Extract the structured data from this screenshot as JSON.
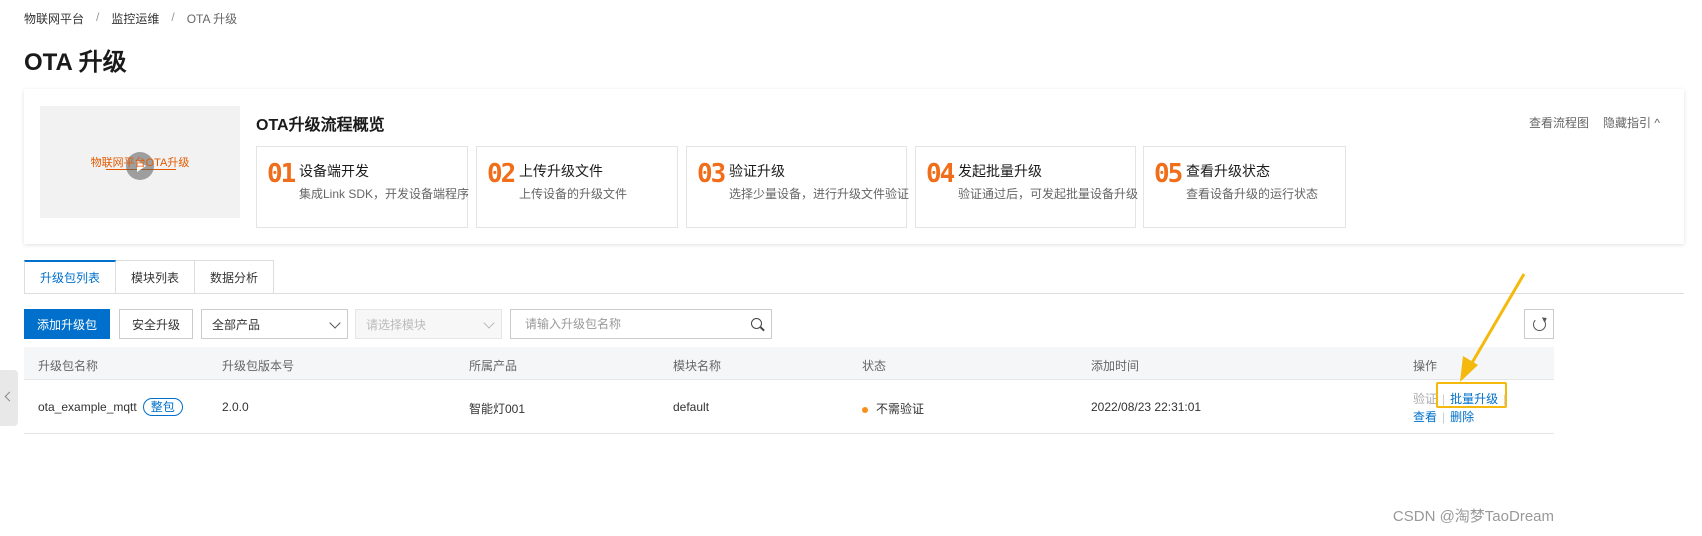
{
  "breadcrumb": [
    "物联网平台",
    "监控运维",
    "OTA 升级"
  ],
  "page_title": "OTA 升级",
  "guide": {
    "video_text": "物联网平台OTA升级",
    "title": "OTA升级流程概览",
    "links": [
      "查看流程图",
      "隐藏指引 ^"
    ],
    "steps": [
      {
        "num": "01",
        "title": "设备端开发",
        "desc": "集成Link SDK，开发设备端程序"
      },
      {
        "num": "02",
        "title": "上传升级文件",
        "desc": "上传设备的升级文件"
      },
      {
        "num": "03",
        "title": "验证升级",
        "desc": "选择少量设备，进行升级文件验证"
      },
      {
        "num": "04",
        "title": "发起批量升级",
        "desc": "验证通过后，可发起批量设备升级"
      },
      {
        "num": "05",
        "title": "查看升级状态",
        "desc": "查看设备升级的运行状态"
      }
    ]
  },
  "tabs": [
    "升级包列表",
    "模块列表",
    "数据分析"
  ],
  "toolbar": {
    "add_label": "添加升级包",
    "secure_label": "安全升级",
    "product_select": "全部产品",
    "module_select": "请选择模块",
    "search_placeholder": "请输入升级包名称"
  },
  "table": {
    "headers": [
      "升级包名称",
      "升级包版本号",
      "所属产品",
      "模块名称",
      "状态",
      "添加时间",
      "操作"
    ],
    "rows": [
      {
        "name": "ota_example_mqtt",
        "badge": "整包",
        "version": "2.0.0",
        "product": "智能灯001",
        "module": "default",
        "status": "不需验证",
        "time": "2022/08/23 22:31:01",
        "actions": {
          "verify": "验证",
          "batch": "批量升级",
          "view": "查看",
          "delete": "删除"
        }
      }
    ]
  },
  "watermark": "CSDN @淘梦TaoDream",
  "colors": {
    "primary": "#0070cc",
    "step_number": "#f06d1a",
    "status_dot": "#f98e1a",
    "highlight": "#f5b80c"
  }
}
